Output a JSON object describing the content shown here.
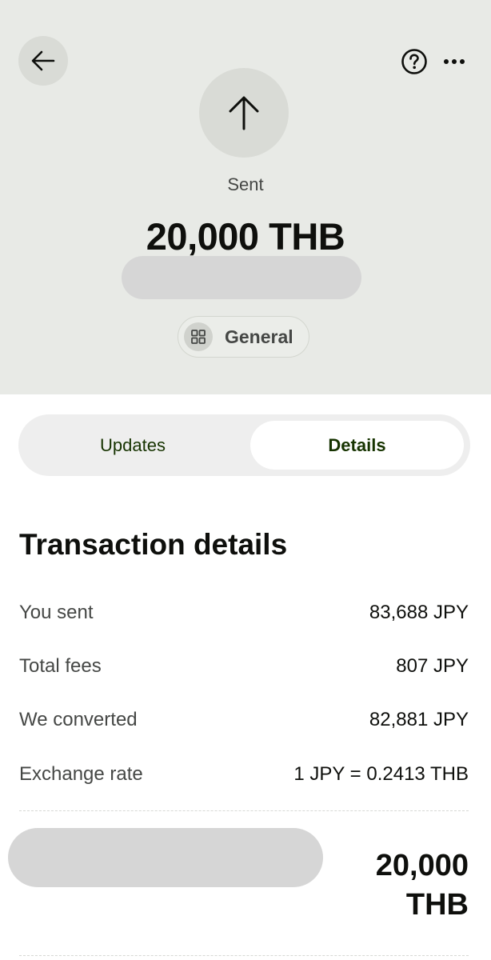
{
  "header": {
    "status": "Sent",
    "amount": "20,000 THB",
    "category": "General",
    "icons": {
      "back": "arrow-left-icon",
      "help": "question-circle-icon",
      "more": "ellipsis-icon",
      "direction": "arrow-up-icon",
      "category": "grid-icon"
    }
  },
  "tabs": [
    {
      "label": "Updates",
      "selected": false
    },
    {
      "label": "Details",
      "selected": true
    }
  ],
  "details": {
    "title": "Transaction details",
    "rows": [
      {
        "label": "You sent",
        "value": "83,688 JPY"
      },
      {
        "label": "Total fees",
        "value": "807 JPY"
      },
      {
        "label": "We converted",
        "value": "82,881 JPY"
      },
      {
        "label": "Exchange rate",
        "value": "1 JPY = 0.2413 THB"
      }
    ],
    "total": {
      "amount": "20,000",
      "currency": "THB"
    }
  },
  "colors": {
    "header_bg": "#e8eae6",
    "text_primary": "#0e0f0c",
    "text_secondary": "#454745",
    "accent_text": "#163300"
  }
}
